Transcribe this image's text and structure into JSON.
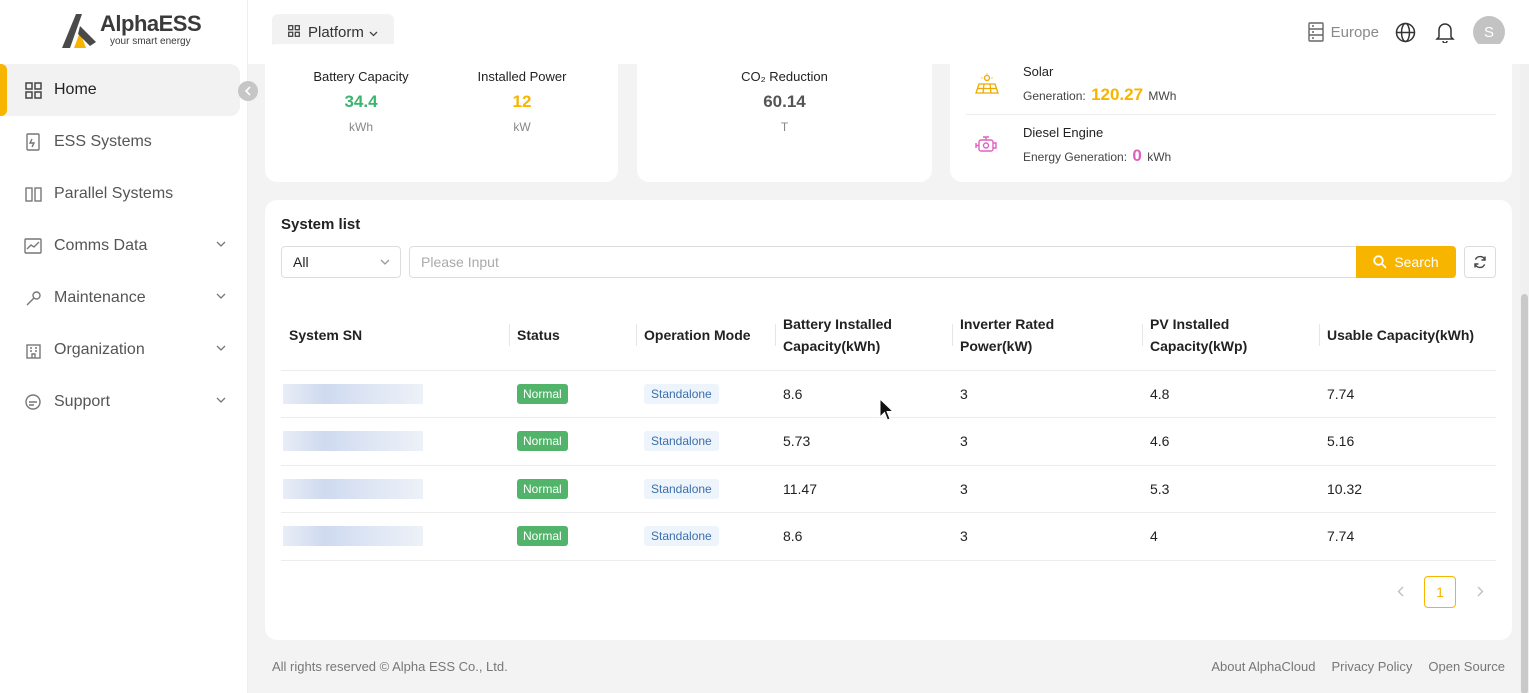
{
  "brand": {
    "name": "AlphaESS",
    "tagline": "your smart energy",
    "accent": "#f7b500"
  },
  "header": {
    "platform_label": "Platform",
    "region": "Europe",
    "avatar_initial": "S"
  },
  "sidebar": {
    "items": [
      {
        "label": "Home",
        "icon": "home-grid-icon",
        "active": true,
        "expandable": false
      },
      {
        "label": "ESS Systems",
        "icon": "ess-device-icon",
        "active": false,
        "expandable": false
      },
      {
        "label": "Parallel Systems",
        "icon": "parallel-icon",
        "active": false,
        "expandable": false
      },
      {
        "label": "Comms Data",
        "icon": "chart-icon",
        "active": false,
        "expandable": true
      },
      {
        "label": "Maintenance",
        "icon": "wrench-icon",
        "active": false,
        "expandable": true
      },
      {
        "label": "Organization",
        "icon": "building-icon",
        "active": false,
        "expandable": true
      },
      {
        "label": "Support",
        "icon": "support-icon",
        "active": false,
        "expandable": true
      }
    ]
  },
  "stats": {
    "battery_capacity": {
      "label": "Battery Capacity",
      "value": "34.4",
      "unit": "kWh",
      "color": "#3cb46e"
    },
    "installed_power": {
      "label": "Installed Power",
      "value": "12",
      "unit": "kW",
      "color": "#f7b500"
    },
    "co2_reduction": {
      "label": "CO₂ Reduction",
      "value": "60.14",
      "unit": "T",
      "color": "#555555"
    }
  },
  "energy": {
    "solar": {
      "title": "Solar",
      "metric_label": "Generation:",
      "value": "120.27",
      "unit": "MWh",
      "color": "#f7b500"
    },
    "diesel": {
      "title": "Diesel Engine",
      "metric_label": "Energy Generation:",
      "value": "0",
      "unit": "kWh",
      "color": "#e060c0"
    }
  },
  "system_list": {
    "title": "System list",
    "filter_selected": "All",
    "search_placeholder": "Please Input",
    "search_button": "Search",
    "columns": {
      "sn": "System SN",
      "status": "Status",
      "mode": "Operation Mode",
      "battery_1": "Battery Installed",
      "battery_2": "Capacity(kWh)",
      "inverter_1": "Inverter Rated",
      "inverter_2": "Power(kW)",
      "pv_1": "PV Installed",
      "pv_2": "Capacity(kWp)",
      "usable": "Usable Capacity(kWh)"
    },
    "rows": [
      {
        "status": "Normal",
        "mode": "Standalone",
        "battery": "8.6",
        "inverter": "3",
        "pv": "4.8",
        "usable": "7.74"
      },
      {
        "status": "Normal",
        "mode": "Standalone",
        "battery": "5.73",
        "inverter": "3",
        "pv": "4.6",
        "usable": "5.16"
      },
      {
        "status": "Normal",
        "mode": "Standalone",
        "battery": "11.47",
        "inverter": "3",
        "pv": "5.3",
        "usable": "10.32"
      },
      {
        "status": "Normal",
        "mode": "Standalone",
        "battery": "8.6",
        "inverter": "3",
        "pv": "4",
        "usable": "7.74"
      }
    ],
    "pagination": {
      "current_page": "1"
    }
  },
  "footer": {
    "copyright": "All rights reserved © Alpha ESS Co., Ltd.",
    "links": [
      "About AlphaCloud",
      "Privacy Policy",
      "Open Source"
    ]
  }
}
